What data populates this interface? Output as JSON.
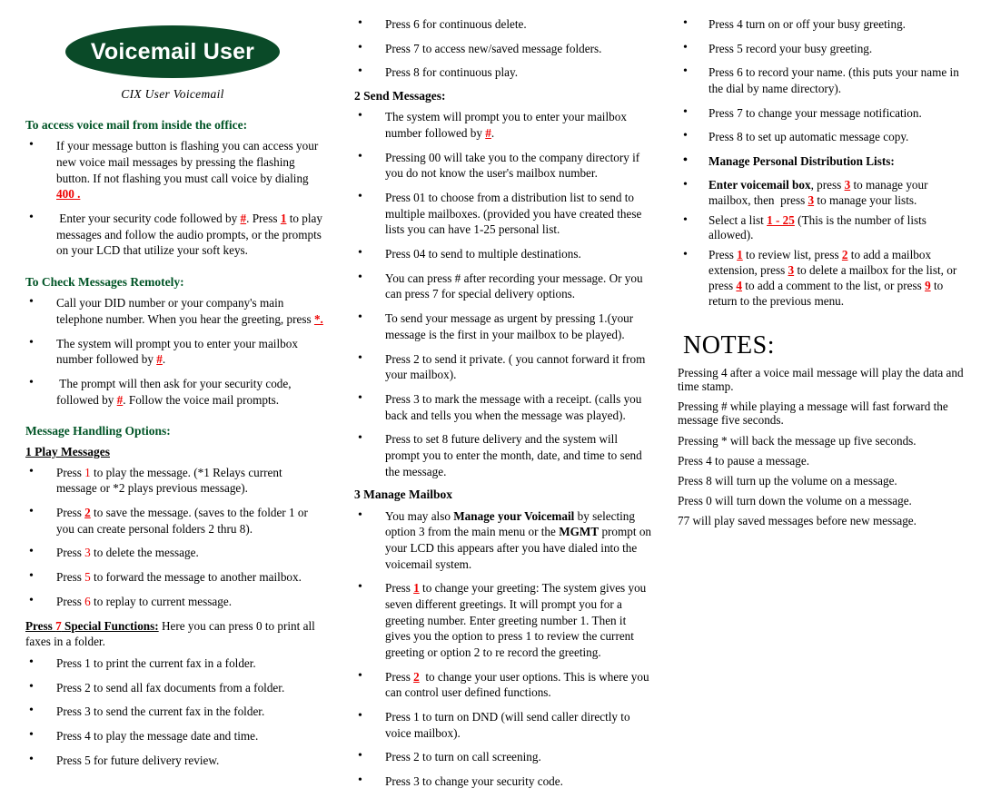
{
  "header": {
    "logo_text": "Voicemail User",
    "subtitle": "CIX User Voicemail",
    "logo_color": "#0a4a28",
    "heading_color": "#005426",
    "key_color": "#ee0000"
  },
  "col1": {
    "heading_access": "To access voice mail from inside the office:",
    "access_items": [
      "If your message button is flashing you can access your new voice mail messages by pressing the flashing button. If  not flashing you must call voice by dialing  400 .",
      "Enter your security code followed by #. Press 1 to play messages and follow the audio prompts, or the prompts on your LCD that utilize your soft keys."
    ],
    "heading_remote": "To Check Messages Remotely:",
    "remote_items": [
      "Call your DID number or your company's  main telephone number.  When you hear the greeting, press *.",
      "The system will prompt you to enter your mailbox number followed by #.",
      "The prompt will then ask for your security code, followed by #.  Follow the voice mail prompts."
    ],
    "heading_handling": "Message Handling Options:",
    "heading_play": "1 Play Messages",
    "play_items": [
      "Press 1 to play the message. (*1 Relays current message or *2 plays previous message).",
      "Press 2 to save the message. (saves to the folder 1 or you can create personal folders 2 thru 8).",
      "Press 3 to delete the message.",
      "Press 5 to forward the message to another mailbox.",
      "Press 6 to replay to current message."
    ],
    "special_label": "Press 7 Special Functions:",
    "special_text": " Here you can press 0 to print all faxes in a folder.",
    "special_items": [
      "Press 1 to print the current fax in a folder.",
      "Press 2 to send all fax documents from a folder.",
      "Press 3 to send the current fax in the folder.",
      "Press 4 to play the message date and time.",
      "Press 5 for future delivery review."
    ]
  },
  "col2": {
    "top_items": [
      "Press 6  for continuous delete.",
      "Press 7 to access new/saved message folders.",
      "Press 8 for continuous play."
    ],
    "heading_send": "2 Send Messages:",
    "send_items": [
      "The system will prompt you to enter your mailbox number followed by #.",
      "Pressing 00 will take you to the company directory if you do not know the user's mailbox number.",
      "Press 01  to choose from a distribution list to send to multiple mailboxes. (provided you have created these lists you can have 1-25 personal list.",
      "Press 04 to send to multiple destinations.",
      "You can press # after recording your message. Or you can press 7 for special delivery options.",
      "To send your message as urgent by pressing 1.(your message is the first in your mailbox to be played).",
      "Press 2 to send it private. ( you cannot forward it from your mailbox).",
      "Press 3 to mark the message with a receipt. (calls you back and tells you when the message was played).",
      "Press to set 8 future delivery and the system will prompt you to enter the month, date, and time to send the message."
    ],
    "heading_manage": "3 Manage Mailbox",
    "manage_items": [
      "You may also Manage your Voicemail by selecting option 3 from the main menu or the MGMT prompt on your LCD this appears after you have dialed into the voicemail system.",
      "Press 1 to change your greeting: The system gives you seven different greetings. It will prompt you for a greeting number. Enter greeting number 1. Then it gives you the option to press 1 to review the current greeting or option 2 to re record the greeting.",
      "Press 2  to change your user options. This is where you can control user defined functions.",
      "Press 1 to turn on DND (will send caller directly to voice mailbox).",
      "Press 2 to turn on call screening.",
      "Press 3 to change your security code."
    ]
  },
  "col3": {
    "top_items": [
      "Press 4 turn on or off your busy greeting.",
      "Press 5 record your busy greeting.",
      "Press 6 to record your name. (this puts your name in the dial by name directory).",
      "Press 7 to change your message notification.",
      "Press 8 to set up automatic message copy."
    ],
    "dist_heading": "Manage Personal Distribution Lists:",
    "dist_items": [
      "Enter voicemail box, press 3 to manage your mailbox, then  press 3 to manage your lists.",
      "Select a list 1 - 25 (This is the number of lists allowed).",
      "Press 1 to review list, press 2 to add a mailbox extension, press 3 to delete a mailbox for the list, or press 4 to add a comment to the list, or press 9 to return to the previous menu."
    ],
    "notes_title": "NOTES:",
    "notes": [
      "Pressing 4 after a voice mail message will play the data and time stamp.",
      "Pressing # while playing a message will fast forward the message five seconds.",
      "Pressing * will back the message up five seconds.",
      "Press 4 to pause a message.",
      "Press 8 will turn up the volume on a message.",
      "Press 0 will turn down the volume on a message.",
      "77 will play saved messages before new message."
    ]
  }
}
